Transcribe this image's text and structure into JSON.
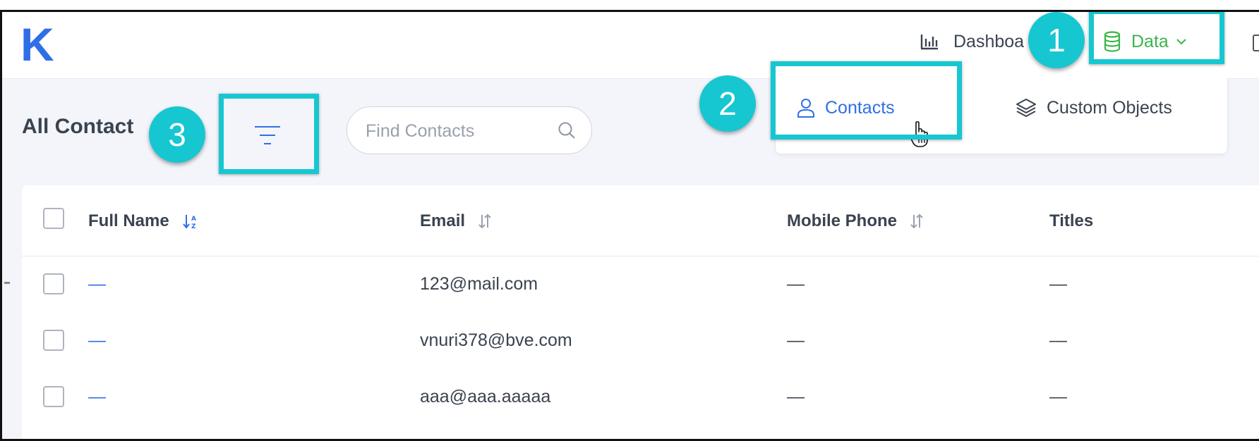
{
  "app": {
    "logo": "K"
  },
  "nav": {
    "dashboard_label": "Dashboa",
    "data_label": "Data"
  },
  "dropdown": {
    "items": [
      {
        "label": "Contacts",
        "icon": "person-icon"
      },
      {
        "label": "Custom Objects",
        "icon": "layers-icon"
      }
    ]
  },
  "page": {
    "title": "All Contact",
    "search_placeholder": "Find Contacts"
  },
  "table": {
    "columns": [
      "Full Name",
      "Email",
      "Mobile Phone",
      "Titles"
    ],
    "rows": [
      {
        "name": "—",
        "email": "123@mail.com",
        "mobile": "—",
        "title": "—"
      },
      {
        "name": "—",
        "email": "vnuri378@bve.com",
        "mobile": "—",
        "title": "—"
      },
      {
        "name": "—",
        "email": "aaa@aaa.aaaaa",
        "mobile": "—",
        "title": "—"
      }
    ]
  },
  "annotations": {
    "badges": [
      "1",
      "2",
      "3"
    ]
  },
  "colors": {
    "brand": "#2f6fe6",
    "data_green": "#3cb44c",
    "highlight": "#16c7d1"
  }
}
